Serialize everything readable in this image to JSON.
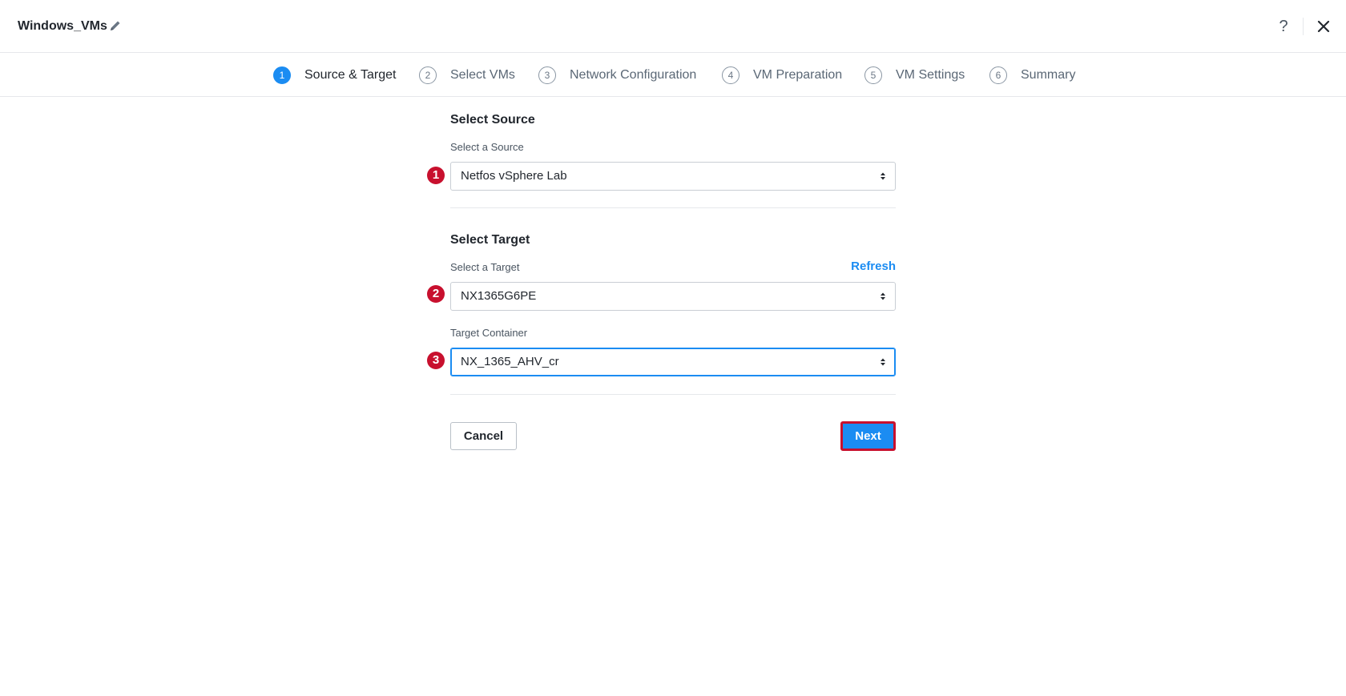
{
  "header": {
    "plan_name": "Windows_VMs",
    "help_label": "?"
  },
  "steps": [
    {
      "num": "1",
      "label": "Source & Target",
      "active": true
    },
    {
      "num": "2",
      "label": "Select VMs",
      "active": false
    },
    {
      "num": "3",
      "label": "Network Configuration",
      "active": false
    },
    {
      "num": "4",
      "label": "VM Preparation",
      "active": false
    },
    {
      "num": "5",
      "label": "VM Settings",
      "active": false
    },
    {
      "num": "6",
      "label": "Summary",
      "active": false
    }
  ],
  "source": {
    "title": "Select Source",
    "label": "Select a Source",
    "value": "Netfos vSphere Lab",
    "marker": "1"
  },
  "target": {
    "title": "Select Target",
    "label": "Select a Target",
    "refresh_label": "Refresh",
    "value": "NX1365G6PE",
    "marker": "2"
  },
  "container": {
    "label": "Target Container",
    "value": "NX_1365_AHV_cr",
    "marker": "3"
  },
  "actions": {
    "cancel_label": "Cancel",
    "next_label": "Next"
  },
  "colors": {
    "accent": "#1b8cf2",
    "marker": "#c8102e"
  }
}
